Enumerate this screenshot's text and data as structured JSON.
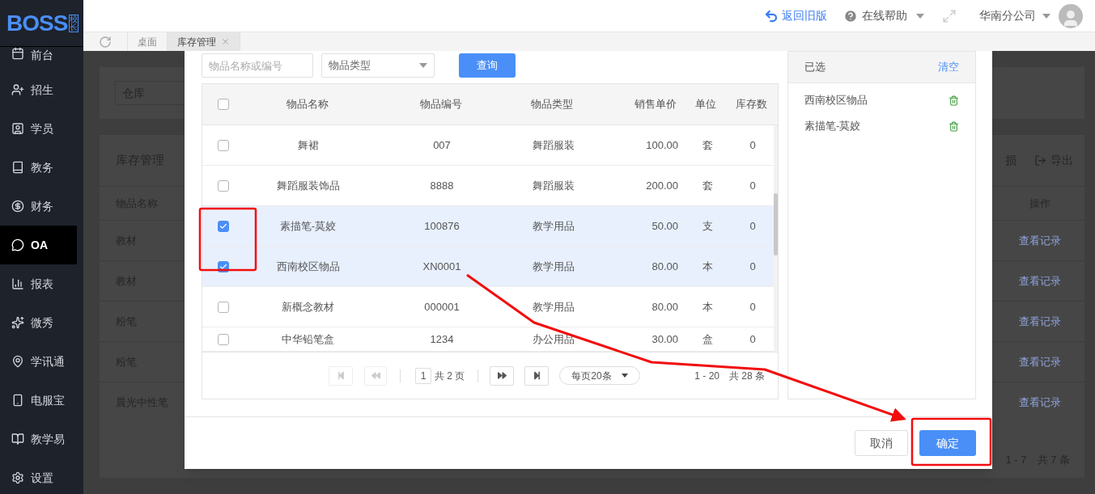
{
  "logo": {
    "text": "BOSS",
    "badge": "校长"
  },
  "topbar": {
    "back_link": "返回旧版",
    "help": "在线帮助",
    "branch": "华南分公司"
  },
  "sidebar": {
    "items": [
      {
        "label": "前台",
        "selected": false
      },
      {
        "label": "招生",
        "selected": false
      },
      {
        "label": "学员",
        "selected": false
      },
      {
        "label": "教务",
        "selected": false
      },
      {
        "label": "财务",
        "selected": false
      },
      {
        "label": "OA",
        "selected": true
      },
      {
        "label": "报表",
        "selected": false
      },
      {
        "label": "微秀",
        "selected": false
      },
      {
        "label": "学讯通",
        "selected": false
      },
      {
        "label": "电服宝",
        "selected": false
      },
      {
        "label": "教学易",
        "selected": false
      },
      {
        "label": "设置",
        "selected": false
      }
    ]
  },
  "tabs": [
    {
      "label": "桌面",
      "selected": false,
      "closable": false
    },
    {
      "label": "库存管理",
      "selected": true,
      "closable": true
    }
  ],
  "background_page": {
    "filter_field": "仓库",
    "table_title": "库存管理",
    "partial_label": "损",
    "export_button": "导出",
    "columns": [
      "物品名称",
      "操作"
    ],
    "rows": [
      {
        "name": "教材",
        "action": "查看记录"
      },
      {
        "name": "教材",
        "action": "查看记录"
      },
      {
        "name": "粉笔",
        "action": "查看记录"
      },
      {
        "name": "粉笔",
        "action": "查看记录"
      },
      {
        "name": "晨光中性笔",
        "action": "查看记录"
      }
    ],
    "pagination": "1 - 7　共 7 条"
  },
  "modal": {
    "search": {
      "placeholder": "物品名称或编号"
    },
    "type_select": "物品类型",
    "query_button": "查询",
    "table": {
      "all_checked": false,
      "columns": [
        "物品名称",
        "物品编号",
        "物品类型",
        "销售单价",
        "单位",
        "库存数"
      ],
      "rows": [
        {
          "name": "舞裙",
          "code": "007",
          "type": "舞蹈服装",
          "price": "100.00",
          "unit": "套",
          "stock": "0",
          "checked": false
        },
        {
          "name": "舞蹈服装饰品",
          "code": "8888",
          "type": "舞蹈服装",
          "price": "200.00",
          "unit": "套",
          "stock": "0",
          "checked": false
        },
        {
          "name": "素描笔-莫姣",
          "code": "100876",
          "type": "教学用品",
          "price": "50.00",
          "unit": "支",
          "stock": "0",
          "checked": true
        },
        {
          "name": "西南校区物品",
          "code": "XN0001",
          "type": "教学用品",
          "price": "80.00",
          "unit": "本",
          "stock": "0",
          "checked": true
        },
        {
          "name": "新概念教材",
          "code": "000001",
          "type": "教学用品",
          "price": "80.00",
          "unit": "本",
          "stock": "0",
          "checked": false
        },
        {
          "name": "中华铅笔盒",
          "code": "1234",
          "type": "办公用品",
          "price": "30.00",
          "unit": "盒",
          "stock": "0",
          "checked": false
        }
      ]
    },
    "pagination": {
      "page": "1",
      "total_pages": "共 2 页",
      "page_size": "每页20条",
      "summary": "1 - 20　共 28 条"
    },
    "selected_panel": {
      "title": "已选",
      "clear": "清空",
      "items": [
        "西南校区物品",
        "素描笔-莫姣"
      ]
    },
    "buttons": {
      "cancel": "取消",
      "confirm": "确定"
    }
  }
}
